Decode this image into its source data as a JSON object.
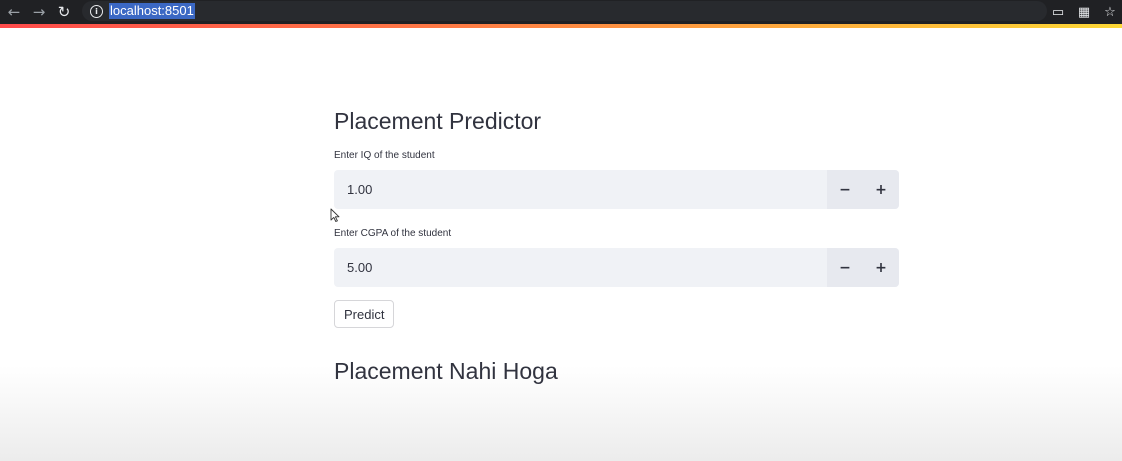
{
  "browser": {
    "back_icon": "←",
    "forward_icon": "→",
    "reload_icon": "↻",
    "url": "localhost:8501",
    "info_icon": "i",
    "cast_icon": "▭",
    "qr_icon": "▦",
    "star_icon": "☆"
  },
  "app": {
    "title": "Placement Predictor",
    "iq_field": {
      "label": "Enter IQ of the student",
      "value": "1.00"
    },
    "cgpa_field": {
      "label": "Enter CGPA of the student",
      "value": "5.00"
    },
    "stepper": {
      "minus": "−",
      "plus": "+"
    },
    "predict_label": "Predict",
    "result_text": "Placement Nahi Hoga"
  },
  "colors": {
    "accent_gradient_start": "#ff4b4b",
    "accent_gradient_end": "#fdd835",
    "input_background": "#f0f2f6",
    "text": "#31333f"
  }
}
